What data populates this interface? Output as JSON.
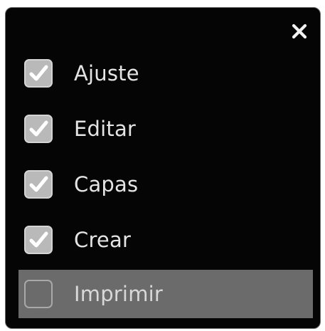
{
  "dialog": {
    "close_icon": "close-icon",
    "items": [
      {
        "label": "Ajuste",
        "checked": true,
        "highlighted": false
      },
      {
        "label": "Editar",
        "checked": true,
        "highlighted": false
      },
      {
        "label": "Capas",
        "checked": true,
        "highlighted": false
      },
      {
        "label": "Crear",
        "checked": true,
        "highlighted": false
      },
      {
        "label": "Imprimir",
        "checked": false,
        "highlighted": true
      }
    ]
  },
  "colors": {
    "panel_background": "#050505",
    "text": "#e4e4e4",
    "checkbox_checked": "#b9b9b9",
    "highlight": "#6b6b6b"
  }
}
